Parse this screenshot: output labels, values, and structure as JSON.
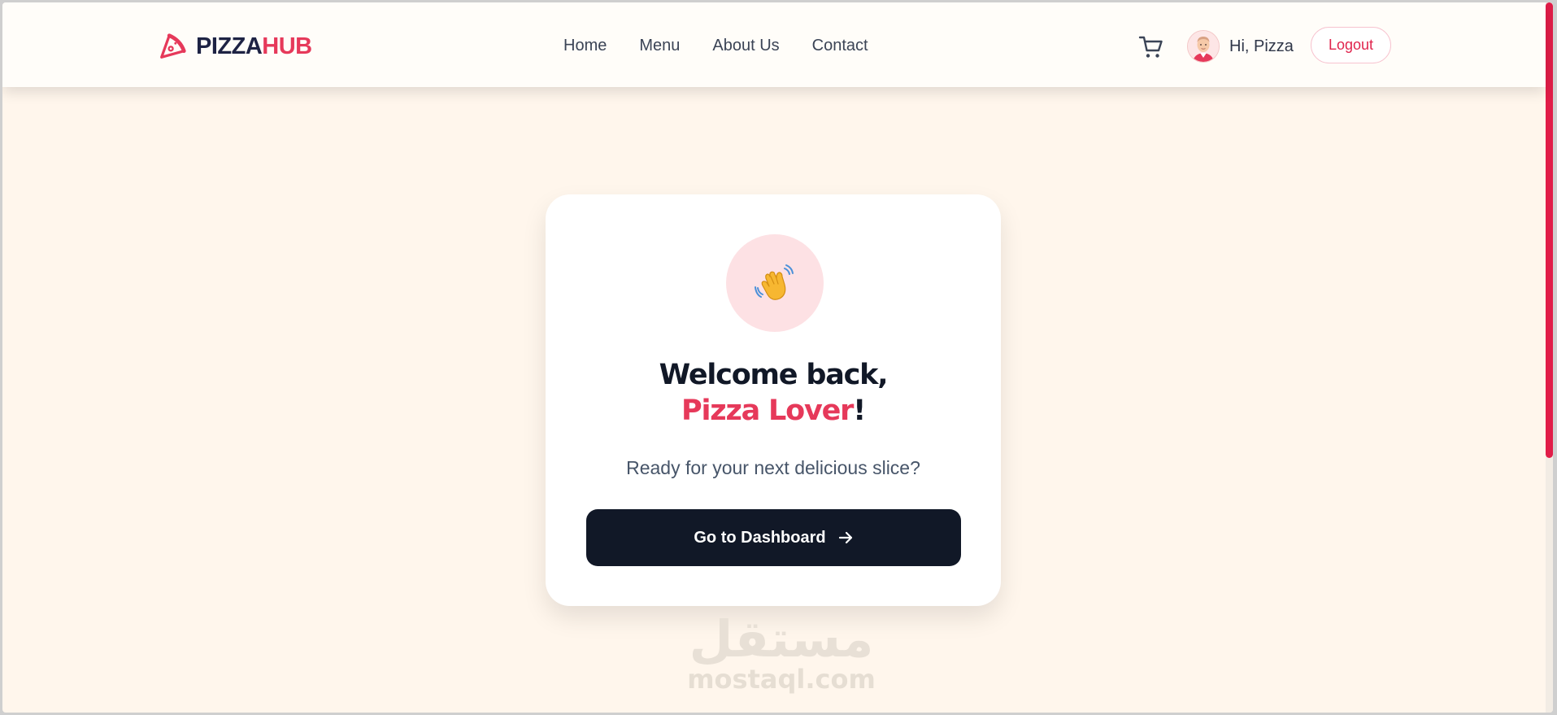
{
  "header": {
    "logo": {
      "brand_part1": "PIZZA",
      "brand_part2": "HUB",
      "icon": "pizza-slice-icon"
    },
    "nav": [
      {
        "label": "Home"
      },
      {
        "label": "Menu"
      },
      {
        "label": "About Us"
      },
      {
        "label": "Contact"
      }
    ],
    "cart_icon": "cart-icon",
    "user": {
      "greeting": "Hi, Pizza",
      "avatar_icon": "user-avatar"
    },
    "logout_label": "Logout"
  },
  "welcome_card": {
    "icon": "waving-hand-icon",
    "title_line1": "Welcome back,",
    "title_name": "Pizza Lover",
    "title_punct": "!",
    "subtitle": "Ready for your next delicious slice?",
    "button_label": "Go to Dashboard",
    "button_icon": "arrow-right-icon"
  },
  "watermark": {
    "arabic": "مستقل",
    "latin": "mostaql.com"
  },
  "colors": {
    "brand_dark": "#1e2344",
    "brand_accent": "#e6395a",
    "page_background": "#fff6ec",
    "button_dark": "#111827",
    "scrollbar": "#e11d48"
  }
}
